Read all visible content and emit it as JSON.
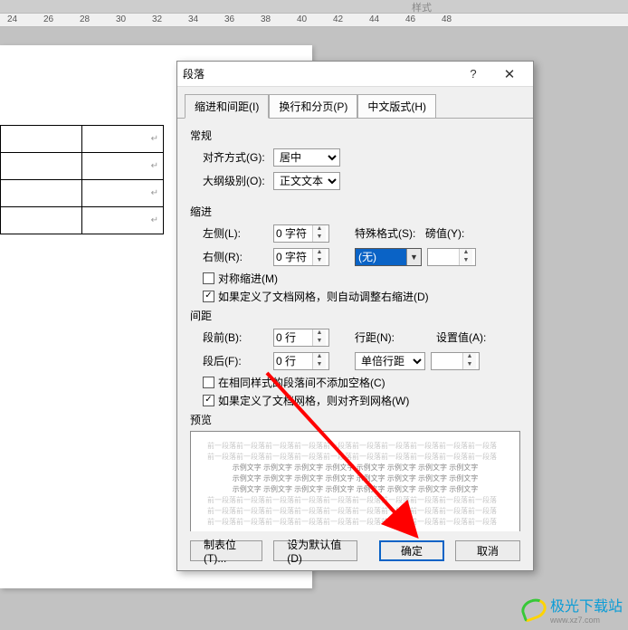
{
  "bg": {
    "styles_label": "样式",
    "ruler_marks": [
      "24",
      "26",
      "28",
      "30",
      "32",
      "34",
      "36",
      "38",
      "40",
      "42",
      "44",
      "46",
      "48"
    ],
    "cell_glyph": "↵"
  },
  "dialog": {
    "title": "段落",
    "help": "?",
    "close": "✕",
    "tabs": [
      {
        "label": "缩进和间距(I)",
        "active": true
      },
      {
        "label": "换行和分页(P)",
        "active": false
      },
      {
        "label": "中文版式(H)",
        "active": false
      }
    ],
    "general": {
      "heading": "常规",
      "align_label": "对齐方式(G):",
      "align_value": "居中",
      "outline_label": "大纲级别(O):",
      "outline_value": "正文文本"
    },
    "indent": {
      "heading": "缩进",
      "left_label": "左侧(L):",
      "left_value": "0 字符",
      "right_label": "右侧(R):",
      "right_value": "0 字符",
      "special_label": "特殊格式(S):",
      "special_value": "(无)",
      "by_label": "磅值(Y):",
      "by_value": "",
      "mirror_label": "对称缩进(M)",
      "autogrid_label": "如果定义了文档网格，则自动调整右缩进(D)"
    },
    "spacing": {
      "heading": "间距",
      "before_label": "段前(B):",
      "before_value": "0 行",
      "after_label": "段后(F):",
      "after_value": "0 行",
      "linespacing_label": "行距(N):",
      "linespacing_value": "单倍行距",
      "at_label": "设置值(A):",
      "at_value": "",
      "nosamestyle_label": "在相同样式的段落间不添加空格(C)",
      "snapgrid_label": "如果定义了文档网格，则对齐到网格(W)"
    },
    "preview": {
      "heading": "预览",
      "light_line": "前一段落前一段落前一段落前一段落前一段落前一段落前一段落前一段落前一段落前一段落",
      "dark_line": "示例文字 示例文字 示例文字 示例文字 示例文字 示例文字 示例文字 示例文字"
    },
    "buttons": {
      "tabs": "制表位(T)...",
      "default": "设为默认值(D)",
      "ok": "确定",
      "cancel": "取消"
    }
  },
  "watermark": {
    "text": "极光下载站",
    "sub": "www.xz7.com"
  }
}
